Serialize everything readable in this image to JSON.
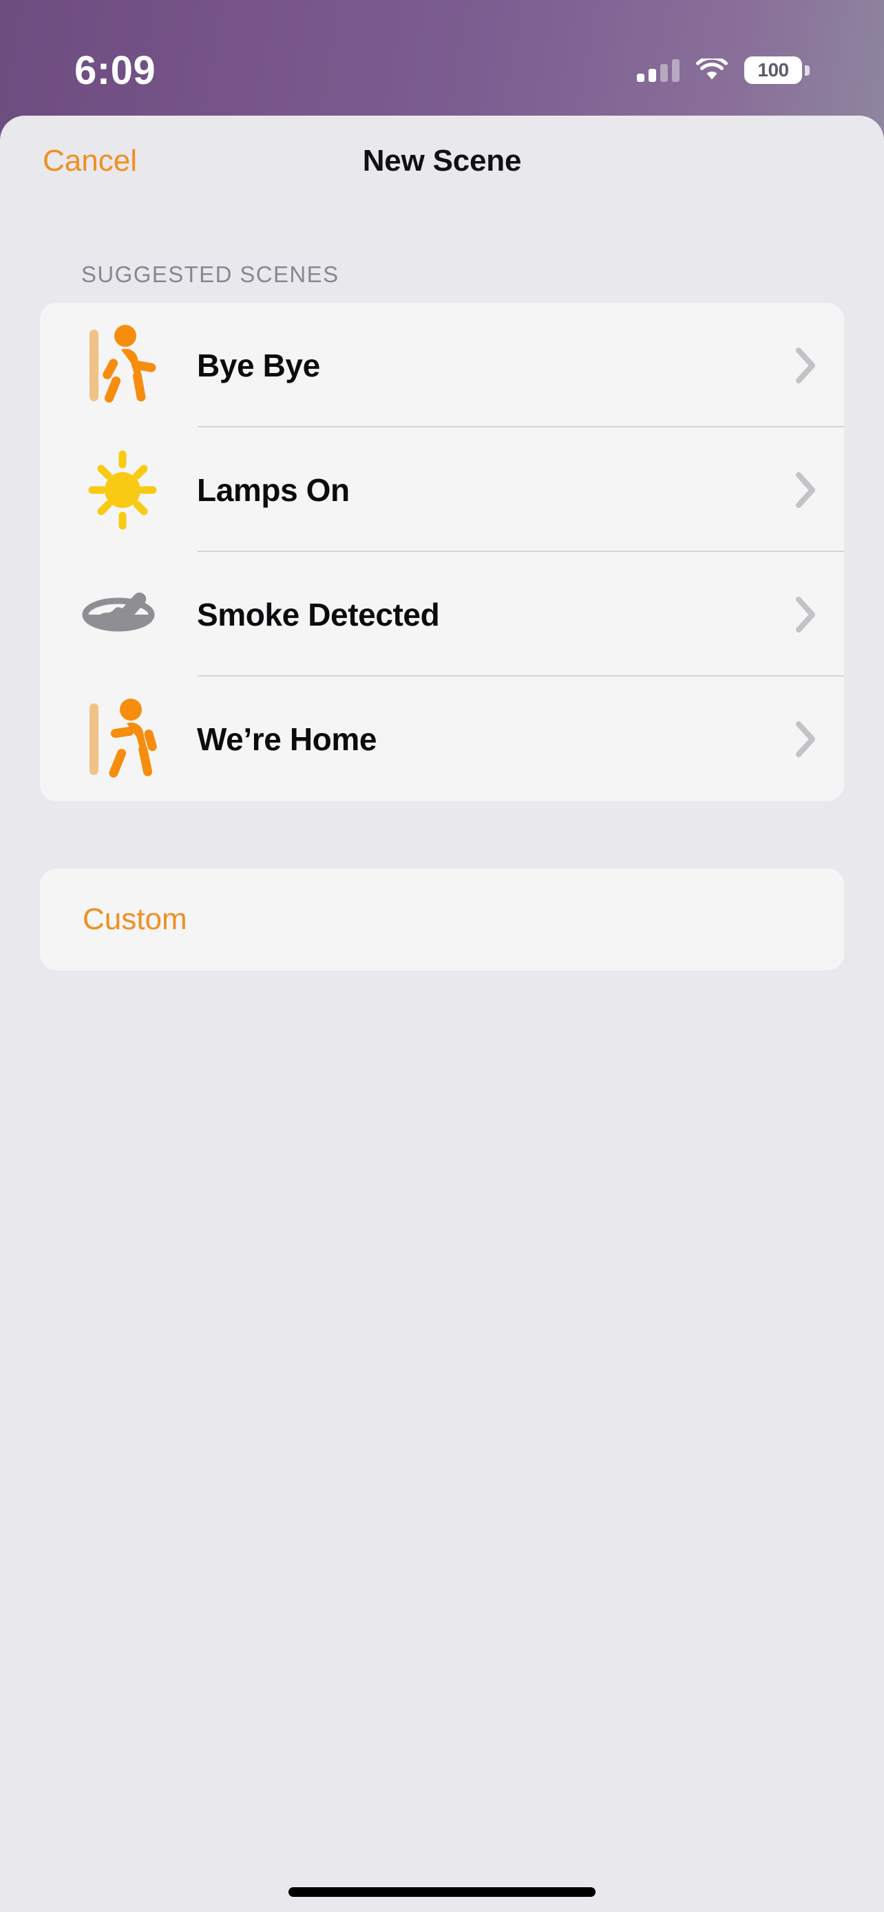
{
  "status_bar": {
    "time": "6:09",
    "battery_level": "100",
    "signal_icon": "cellular-signal-icon",
    "wifi_icon": "wifi-icon",
    "battery_icon": "battery-icon",
    "signal_bars_filled": 2,
    "signal_bars_total": 4
  },
  "nav": {
    "cancel_label": "Cancel",
    "title": "New Scene"
  },
  "section": {
    "header": "SUGGESTED SCENES"
  },
  "scenes": [
    {
      "label": "Bye Bye",
      "icon": "figure-walk-departure-icon",
      "chevron": "chevron-right-icon"
    },
    {
      "label": "Lamps On",
      "icon": "sun-max-fill-icon",
      "chevron": "chevron-right-icon"
    },
    {
      "label": "Smoke Detected",
      "icon": "frying-pan-icon",
      "chevron": "chevron-right-icon"
    },
    {
      "label": "We’re Home",
      "icon": "figure-walk-arrival-icon",
      "chevron": "chevron-right-icon"
    }
  ],
  "custom": {
    "label": "Custom"
  },
  "colors": {
    "accent_orange": "#ef9021",
    "icon_orange": "#f68d0e",
    "icon_orange_light": "#f1c286",
    "icon_yellow": "#f8ca14",
    "icon_gray": "#8e8e93",
    "background": "#e9e8ed",
    "card": "#f5f5f6",
    "separator": "#d4d3d8",
    "title_text": "#111114",
    "section_header_text": "#88868f",
    "chevron": "#c2c2c7",
    "status_bar_gradient_start": "#6d4c80",
    "status_bar_gradient_end": "#9ba0ab"
  }
}
